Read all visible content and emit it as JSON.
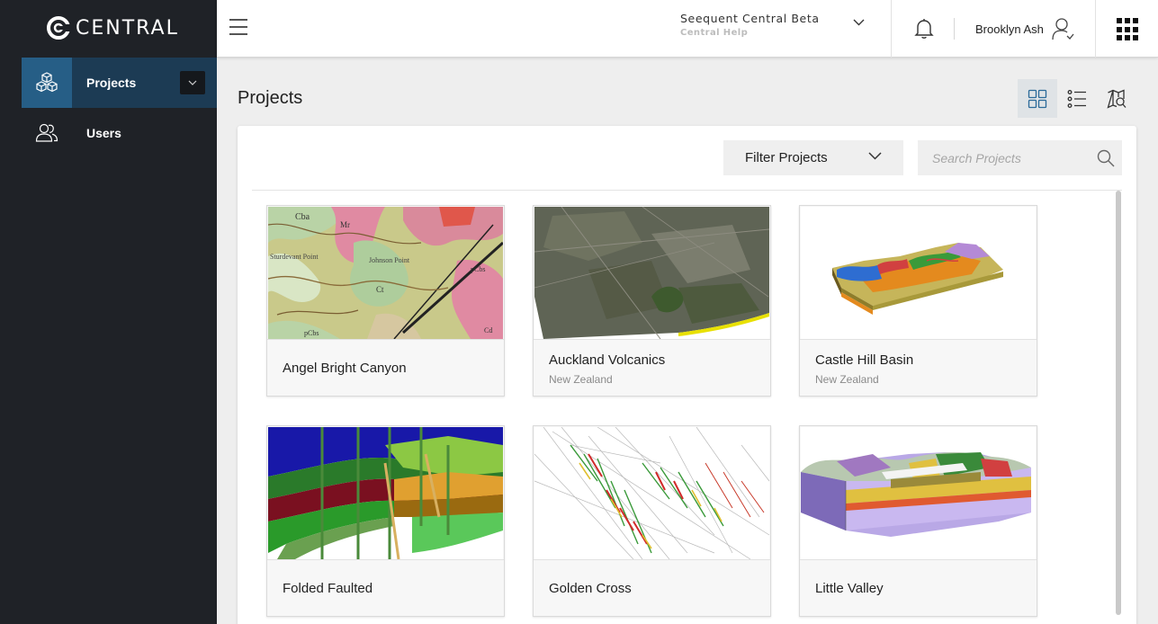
{
  "app": {
    "logo_text": "CENTRAL",
    "brand_color": "#1f2227",
    "accent": "#265e86"
  },
  "sidebar": {
    "items": [
      {
        "label": "Projects",
        "icon": "cubes-icon",
        "active": true
      },
      {
        "label": "Users",
        "icon": "users-icon",
        "active": false
      }
    ]
  },
  "header": {
    "org_title": "Seequent Central Beta",
    "org_subtitle": "Central Help",
    "user_name": "Brooklyn Ash"
  },
  "page": {
    "title": "Projects",
    "views": [
      "grid-view-icon",
      "list-view-icon",
      "map-view-icon"
    ],
    "active_view": "grid"
  },
  "toolbar": {
    "filter_label": "Filter Projects",
    "search_placeholder": "Search Projects",
    "search_value": ""
  },
  "projects": [
    {
      "name": "Angel Bright Canyon",
      "location": ""
    },
    {
      "name": "Auckland Volcanics",
      "location": "New Zealand"
    },
    {
      "name": "Castle Hill Basin",
      "location": "New Zealand"
    },
    {
      "name": "Folded Faulted",
      "location": ""
    },
    {
      "name": "Golden Cross",
      "location": ""
    },
    {
      "name": "Little Valley",
      "location": ""
    }
  ],
  "thumbnails": {
    "angel_map_labels": [
      "Cba",
      "Mr",
      "Sturdevant Point",
      "Johnson Point",
      "Ct",
      "pCbs",
      "pCbs",
      "Cd"
    ]
  }
}
